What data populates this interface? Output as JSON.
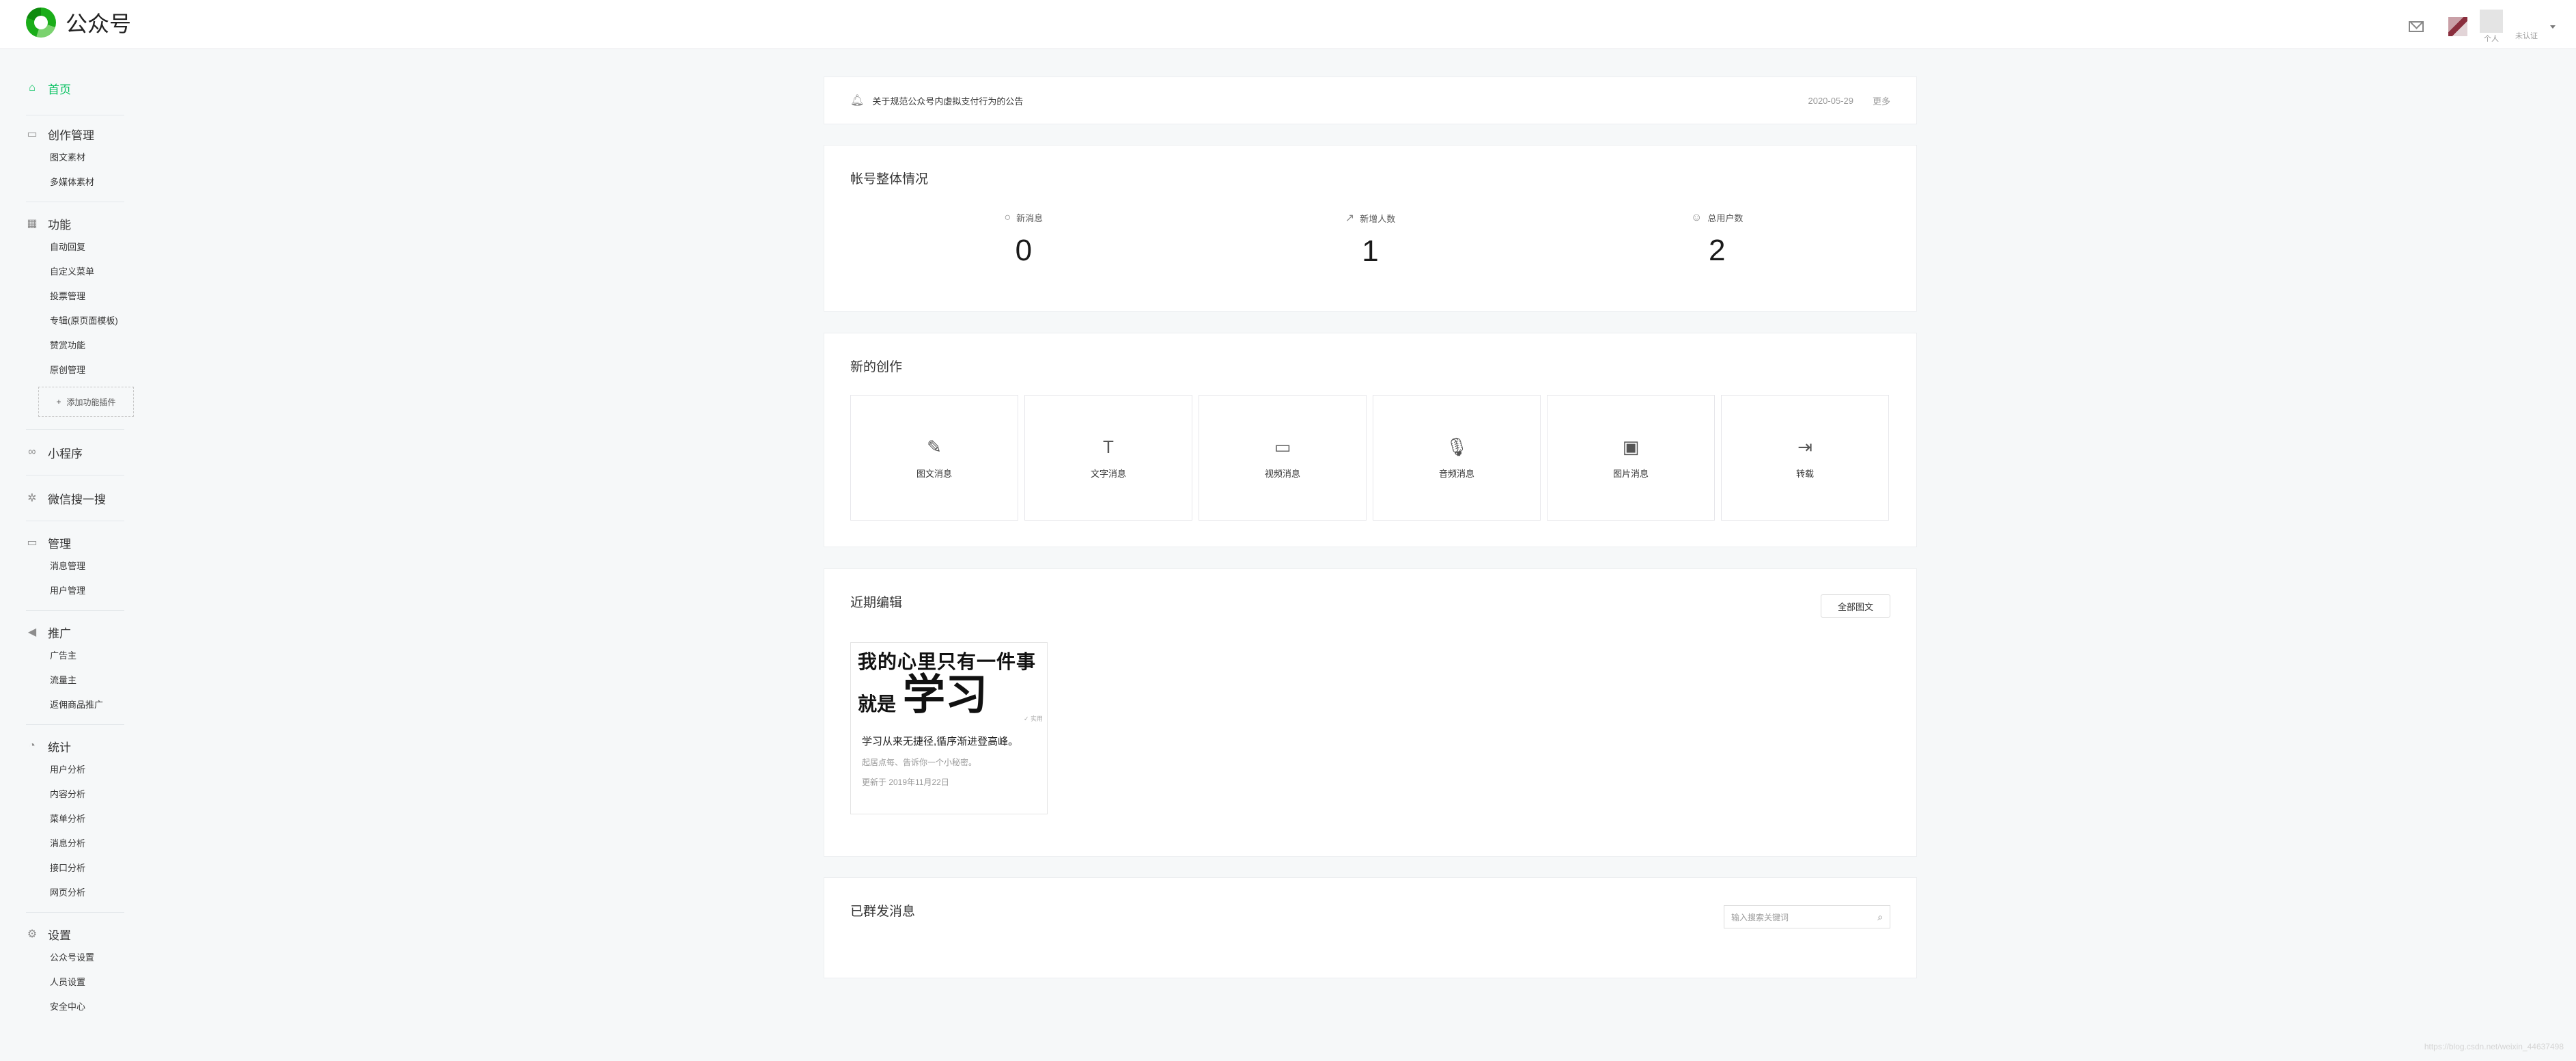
{
  "header": {
    "app_title": "公众号",
    "account_type": "个人",
    "verify_status": "未认证"
  },
  "sidebar": {
    "home": "首页",
    "groups": [
      {
        "title": "创作管理",
        "icon": "tray-icon",
        "items": [
          "图文素材",
          "多媒体素材"
        ]
      },
      {
        "title": "功能",
        "icon": "grid-icon",
        "items": [
          "自动回复",
          "自定义菜单",
          "投票管理",
          "专辑(原页面模板)",
          "赞赏功能",
          "原创管理"
        ],
        "add_label": "添加功能插件"
      },
      {
        "title": "小程序",
        "icon": "link-icon",
        "items": []
      },
      {
        "title": "微信搜一搜",
        "icon": "star-icon",
        "items": []
      },
      {
        "title": "管理",
        "icon": "tray-icon",
        "items": [
          "消息管理",
          "用户管理"
        ]
      },
      {
        "title": "推广",
        "icon": "megaphone-icon",
        "items": [
          "广告主",
          "流量主",
          "返佣商品推广"
        ]
      },
      {
        "title": "统计",
        "icon": "pie-icon",
        "items": [
          "用户分析",
          "内容分析",
          "菜单分析",
          "消息分析",
          "接口分析",
          "网页分析"
        ]
      },
      {
        "title": "设置",
        "icon": "gear-icon",
        "items": [
          "公众号设置",
          "人员设置",
          "安全中心"
        ]
      }
    ]
  },
  "notice": {
    "text": "关于规范公众号内虚拟支付行为的公告",
    "date": "2020-05-29",
    "more": "更多"
  },
  "overview": {
    "title": "帐号整体情况",
    "stats": [
      {
        "label": "新消息",
        "value": "0",
        "icon": "chat-bubble-icon"
      },
      {
        "label": "新增人数",
        "value": "1",
        "icon": "trend-up-icon"
      },
      {
        "label": "总用户数",
        "value": "2",
        "icon": "user-icon"
      }
    ]
  },
  "creation": {
    "title": "新的创作",
    "tiles": [
      {
        "label": "图文消息",
        "icon": "pencil-icon"
      },
      {
        "label": "文字消息",
        "icon": "text-icon"
      },
      {
        "label": "视频消息",
        "icon": "video-icon"
      },
      {
        "label": "音频消息",
        "icon": "microphone-icon"
      },
      {
        "label": "图片消息",
        "icon": "image-icon"
      },
      {
        "label": "转载",
        "icon": "export-icon"
      }
    ]
  },
  "recent": {
    "title": "近期编辑",
    "all_button": "全部图文",
    "article": {
      "cover_line1": "我的心里只有一件事",
      "cover_small": "就是",
      "cover_big": "学习",
      "cover_mark": "✓ 实用",
      "title": "学习从来无捷径,循序渐进登高峰。",
      "meta": "起居点每、告诉你一个小秘密。",
      "date": "更新于 2019年11月22日"
    }
  },
  "sent": {
    "title": "已群发消息",
    "search_placeholder": "输入搜索关键词"
  },
  "watermark": "https://blog.csdn.net/weixin_44637498"
}
